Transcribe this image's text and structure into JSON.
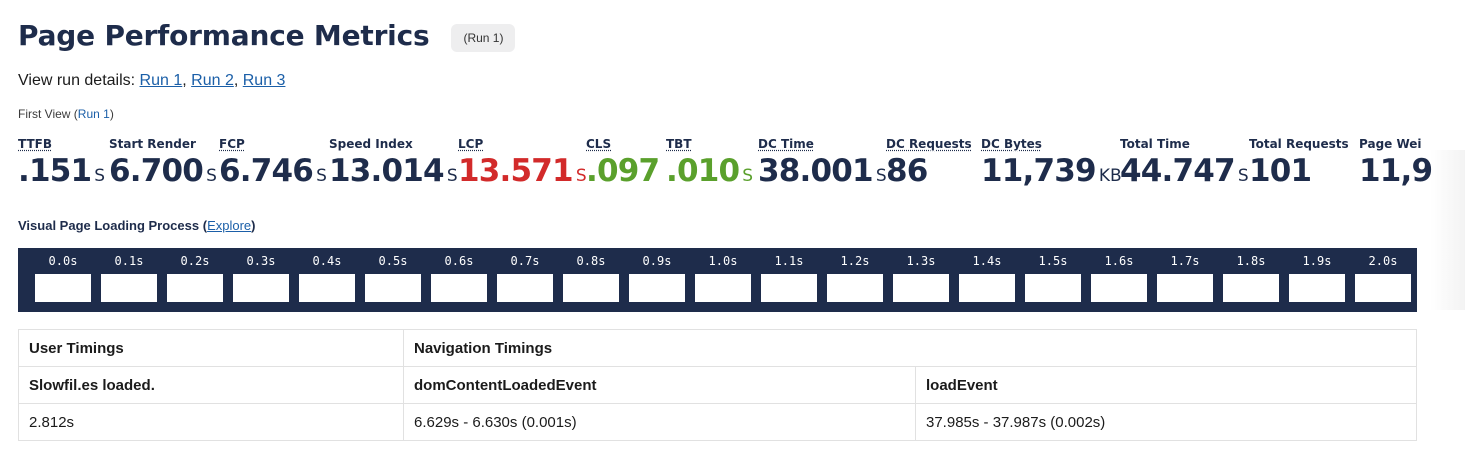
{
  "header": {
    "title": "Page Performance Metrics",
    "run_badge": "(Run 1)"
  },
  "run_links": {
    "prefix": "View run details: ",
    "links": [
      "Run 1",
      "Run 2",
      "Run 3"
    ]
  },
  "first_view": {
    "label": "First View (",
    "link": "Run 1",
    "suffix": ")"
  },
  "metrics": [
    {
      "label": "TTFB",
      "value": ".151",
      "unit": "S",
      "status": "normal"
    },
    {
      "label": "Start Render",
      "value": "6.700",
      "unit": "S",
      "status": "normal"
    },
    {
      "label": "FCP",
      "value": "6.746",
      "unit": "S",
      "status": "normal"
    },
    {
      "label": "Speed Index",
      "value": "13.014",
      "unit": "S",
      "status": "normal"
    },
    {
      "label": "LCP",
      "value": "13.571",
      "unit": "S",
      "status": "poor"
    },
    {
      "label": "CLS",
      "value": ".097",
      "unit": "",
      "status": "good"
    },
    {
      "label": "TBT",
      "value": ".010",
      "unit": "S",
      "status": "good"
    },
    {
      "label": "DC Time",
      "value": "38.001",
      "unit": "S",
      "status": "normal"
    },
    {
      "label": "DC Requests",
      "value": "86",
      "unit": "",
      "status": "normal"
    },
    {
      "label": "DC Bytes",
      "value": "11,739",
      "unit": "KB",
      "status": "normal"
    },
    {
      "label": "Total Time",
      "value": "44.747",
      "unit": "S",
      "status": "normal"
    },
    {
      "label": "Total Requests",
      "value": "101",
      "unit": "",
      "status": "normal"
    },
    {
      "label": "Page Wei",
      "value": "11,9",
      "unit": "",
      "status": "normal"
    }
  ],
  "colors": {
    "text": "#1e2c4b",
    "poor": "#d22a2a",
    "good": "#5aa02c",
    "link": "#1b5fa8",
    "filmstrip_bg": "#1e2c4b"
  },
  "visual_loading": {
    "title": "Visual Page Loading Process ",
    "explore_open": "(",
    "explore_link": "Explore",
    "explore_close": ")",
    "frames": [
      "0.0s",
      "0.1s",
      "0.2s",
      "0.3s",
      "0.4s",
      "0.5s",
      "0.6s",
      "0.7s",
      "0.8s",
      "0.9s",
      "1.0s",
      "1.1s",
      "1.2s",
      "1.3s",
      "1.4s",
      "1.5s",
      "1.6s",
      "1.7s",
      "1.8s",
      "1.9s",
      "2.0s"
    ]
  },
  "timings": {
    "user_header": "User Timings",
    "nav_header": "Navigation Timings",
    "columns": [
      "Slowfil.es loaded.",
      "domContentLoadedEvent",
      "loadEvent"
    ],
    "values": [
      "2.812s",
      "6.629s - 6.630s (0.001s)",
      "37.985s - 37.987s (0.002s)"
    ]
  }
}
